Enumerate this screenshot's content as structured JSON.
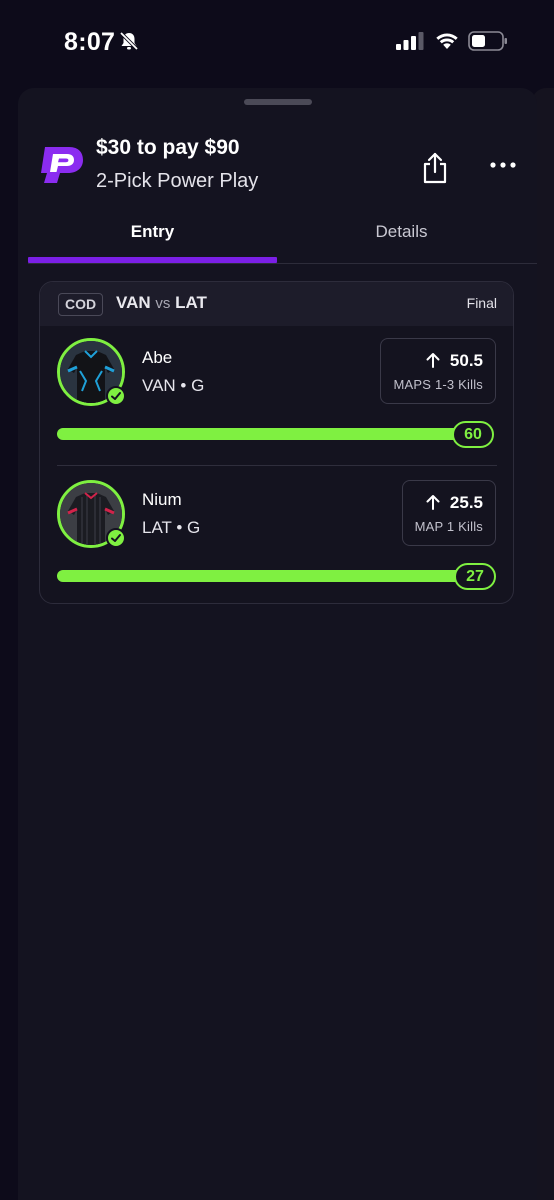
{
  "status_bar": {
    "time": "8:07",
    "icons": [
      "bell-slash-icon",
      "cellular-signal-icon",
      "wifi-icon",
      "battery-icon"
    ]
  },
  "header": {
    "logo": "prizepicks-logo",
    "title": "$30 to pay $90",
    "subtitle": "2-Pick Power Play",
    "actions": [
      "share-icon",
      "more-icon"
    ]
  },
  "tabs": [
    {
      "label": "Entry",
      "active": true
    },
    {
      "label": "Details",
      "active": false
    }
  ],
  "game": {
    "league": "COD",
    "team_a": "VAN",
    "vs": "vs",
    "team_b": "LAT",
    "status": "Final"
  },
  "picks": [
    {
      "name": "Abe",
      "team_pos": "VAN • G",
      "direction": "arrow-up-icon",
      "line": "50.5",
      "stat": "MAPS 1-3 Kills",
      "result": "60",
      "progress_fraction": 1.0
    },
    {
      "name": "Nium",
      "team_pos": "LAT • G",
      "direction": "arrow-up-icon",
      "line": "25.5",
      "stat": "MAP 1 Kills",
      "result": "27",
      "progress_fraction": 1.0
    }
  ],
  "colors": {
    "background": "#0d0b1a",
    "sheet": "#141320",
    "accent_purple": "#7b1fe6",
    "hit_green": "#7ff041"
  }
}
